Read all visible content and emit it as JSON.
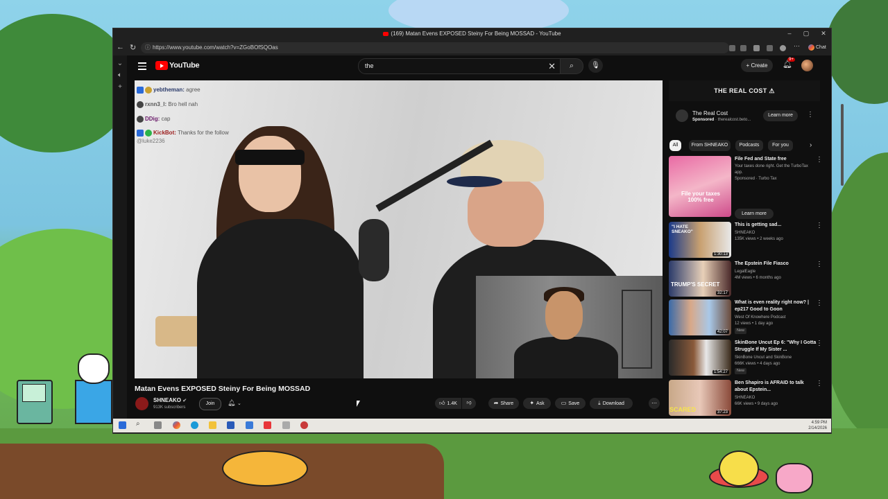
{
  "browser": {
    "window_title": "(169) Matan Evens EXPOSED Steiny For Being MOSSAD - YouTube",
    "url": "https://www.youtube.com/watch?v=ZGoBOfSQOas",
    "chat_label": "Chat"
  },
  "youtube": {
    "logo": "YouTube",
    "search_query": "the",
    "create_label": "Create",
    "notification_count": "9+"
  },
  "live_chat": [
    {
      "user": "yebtheman:",
      "message": "agree"
    },
    {
      "user": "rxnn3_l:",
      "message": "Bro hell nah"
    },
    {
      "user": "DDig:",
      "message": "cap"
    },
    {
      "user": "KickBot:",
      "message": "Thanks for the follow",
      "sub": "@luke2236"
    }
  ],
  "video": {
    "title": "Matan Evens EXPOSED Steiny For Being MOSSAD",
    "channel": "SHNEAKO",
    "subscribers": "913K subscribers",
    "join_label": "Join",
    "likes": "1.4K",
    "share_label": "Share",
    "ask_label": "Ask",
    "save_label": "Save",
    "download_label": "Download"
  },
  "ad": {
    "banner_text": "THE REAL COST",
    "name": "The Real Cost",
    "sponsored": "Sponsored",
    "domain": "therealcost.beto...",
    "cta": "Learn more"
  },
  "chips": [
    "All",
    "From SHNEAKO",
    "Podcasts",
    "For you"
  ],
  "recommendations": [
    {
      "title": "File Fed and State free",
      "line1": "Your taxes done right. Get the TurboTax app.",
      "line2": "Sponsored · Turbo Tax",
      "thumb_text": "File your taxes 100% free",
      "cta": "Learn more",
      "duration": ""
    },
    {
      "title": "This is getting sad...",
      "line1": "SHNEAKO",
      "line2": "135K views • 2 weeks ago",
      "thumb_text": "\"I HATE SNEAKO\"",
      "duration": "1:30:13"
    },
    {
      "title": "The Epstein File Fiasco",
      "line1": "LegalEagle",
      "line2": "4M views • 6 months ago",
      "thumb_text": "TRUMP'S SECRET",
      "duration": "32:17"
    },
    {
      "title": "What is even reality right now? | ep217 Good to Goon",
      "line1": "West Of Knowhere Podcast",
      "line2": "12 views • 1 day ago",
      "badge": "New",
      "thumb_text": "",
      "duration": "42:07"
    },
    {
      "title": "SkinBone Uncut Ep 6: \"Why I Gotta Struggle If My Sister ...",
      "line1": "SkinBone Uncut and SkinBone",
      "line2": "666K views • 4 days ago",
      "badge": "New",
      "thumb_text": "",
      "duration": "1:54:27"
    },
    {
      "title": "Ben Shapiro is AFRAID to talk about Epstein...",
      "line1": "SHNEAKO",
      "line2": "66K views • 9 days ago",
      "thumb_text": "SCARED",
      "duration": "37:23"
    }
  ],
  "taskbar": {
    "time": "4:59 PM",
    "date": "2/14/2026"
  }
}
